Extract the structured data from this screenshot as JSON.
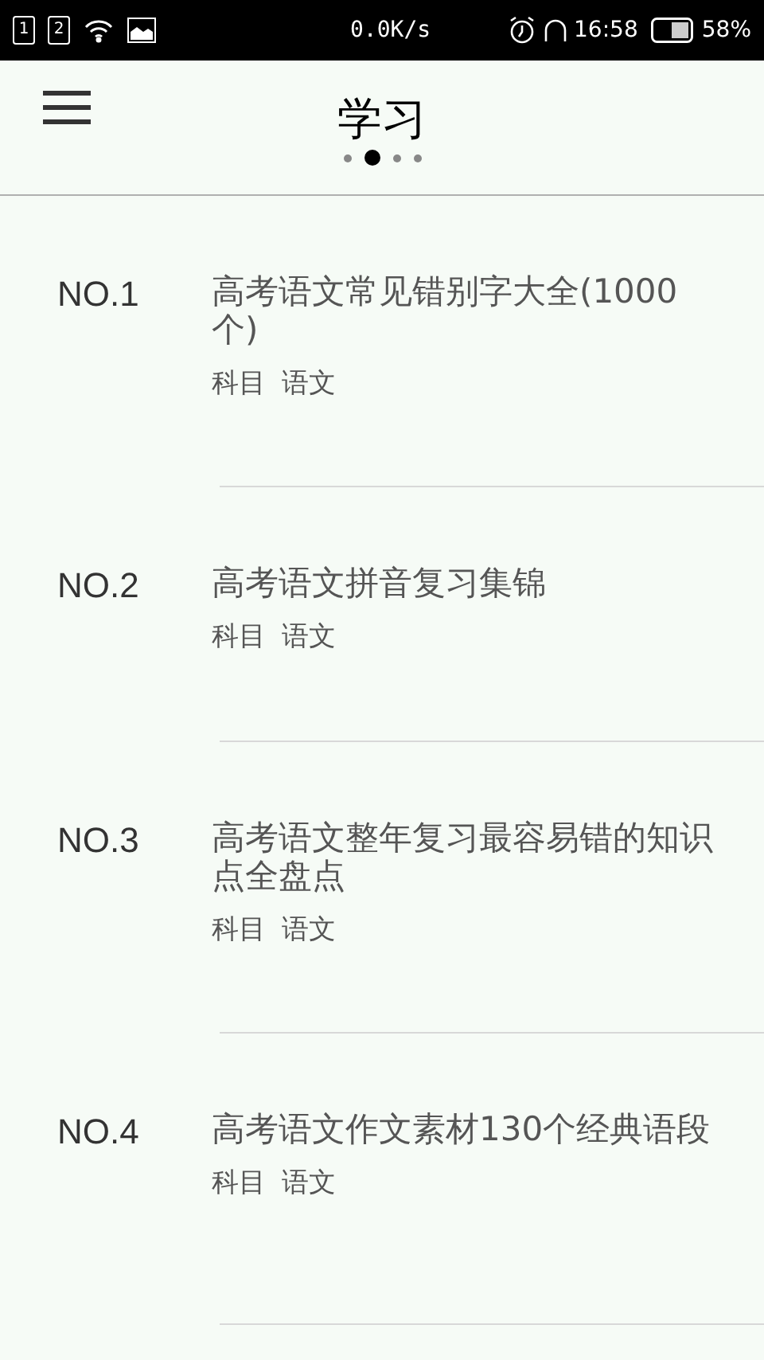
{
  "status_bar": {
    "sim_slots": [
      "1",
      "2"
    ],
    "speed": "0.0K/s",
    "time": "16:58",
    "battery": "58%"
  },
  "header": {
    "title": "学习",
    "pages": [
      {
        "selected": false
      },
      {
        "selected": true
      },
      {
        "selected": false
      },
      {
        "selected": false
      }
    ]
  },
  "items": [
    {
      "rank": "NO.1",
      "title": "高考语文常见错别字大全(1000个)",
      "subject_label": "科目",
      "subject": "语文"
    },
    {
      "rank": "NO.2",
      "title": "高考语文拼音复习集锦",
      "subject_label": "科目",
      "subject": "语文"
    },
    {
      "rank": "NO.3",
      "title": "高考语文整年复习最容易错的知识点全盘点",
      "subject_label": "科目",
      "subject": "语文"
    },
    {
      "rank": "NO.4",
      "title": "高考语文作文素材130个经典语段",
      "subject_label": "科目",
      "subject": "语文"
    }
  ]
}
